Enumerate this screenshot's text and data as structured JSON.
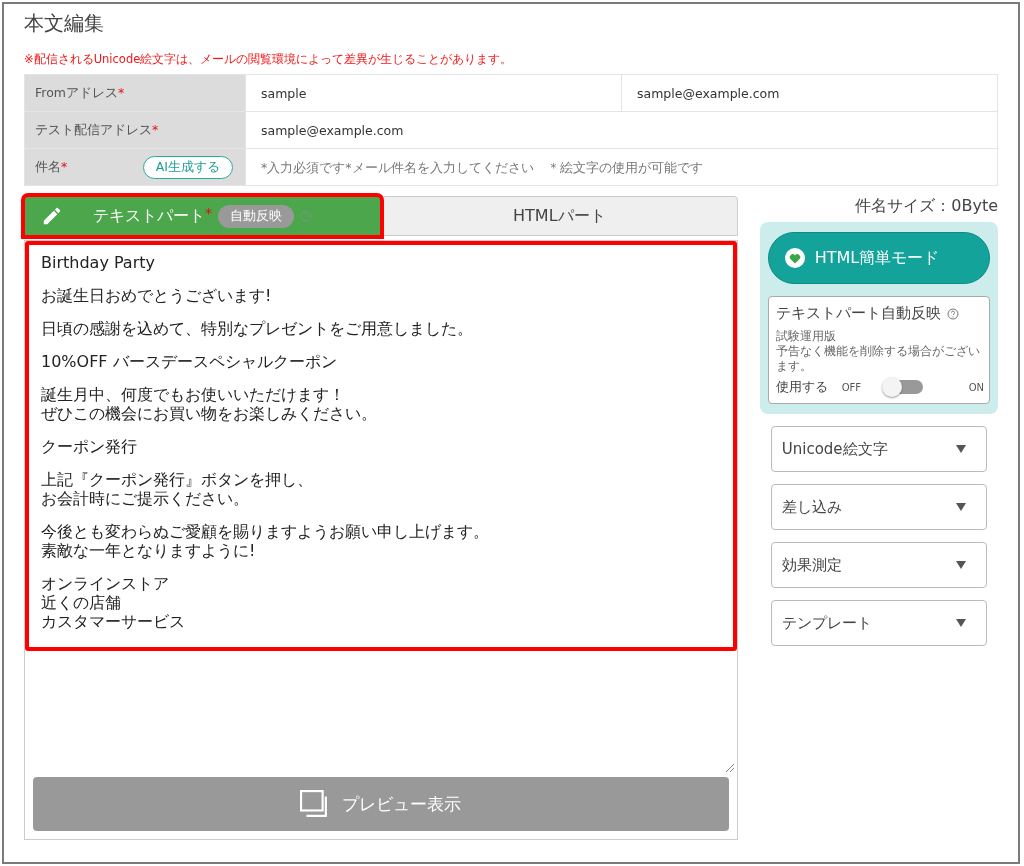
{
  "title": "本文編集",
  "notice": "※配信されるUnicode絵文字は、メールの閲覧環境によって差異が生じることがあります。",
  "fields": [
    {
      "label": "Fromアドレス",
      "required_mark": "*",
      "values": [
        "sample",
        "sample@example.com"
      ]
    },
    {
      "label": "テスト配信アドレス",
      "required_mark": "*",
      "values": [
        "sample@example.com"
      ]
    },
    {
      "label": "件名",
      "required_mark": "*",
      "ai_button": "AI生成する",
      "placeholder": "*入力必須です*メール件名を入力してください　＊絵文字の使用が可能です"
    }
  ],
  "tabs": [
    {
      "label": "テキストパート",
      "required_mark": "*",
      "badge": "自動反映",
      "selected": true,
      "highlighted": true
    },
    {
      "label": "HTMLパート",
      "selected": false,
      "highlighted": false
    }
  ],
  "editor": {
    "highlighted": true,
    "paragraphs": [
      [
        "Birthday Party"
      ],
      [
        "お誕生日おめでとうございます!"
      ],
      [
        "日頃の感謝を込めて、特別なプレゼントをご用意しました。"
      ],
      [
        "10%OFF バースデースペシャルクーポン"
      ],
      [
        "誕生月中、何度でもお使いいただけます！",
        "ぜひこの機会にお買い物をお楽しみください。"
      ],
      [
        "クーポン発行"
      ],
      [
        "上記『クーポン発行』ボタンを押し、",
        "お会計時にご提示ください。"
      ],
      [
        "今後とも変わらぬご愛顧を賜りますようお願い申し上げます。",
        "素敵な一年となりますように!"
      ],
      [
        "オンラインストア",
        "近くの店舗",
        "カスタマーサービス"
      ]
    ]
  },
  "preview_button": "プレビュー表示",
  "subject_size": "件名サイズ：0Byte",
  "html_mode_button": "HTML簡単モード",
  "auto_reflect": {
    "title": "テキストパート自動反映",
    "note": [
      "試験運用版",
      "予告なく機能を削除する場合がございます。"
    ],
    "use_label": "使用する",
    "off_label": "OFF",
    "on_label": "ON",
    "on": false
  },
  "dropdowns": [
    "Unicode絵文字",
    "差し込み",
    "効果測定",
    "テンプレート"
  ]
}
